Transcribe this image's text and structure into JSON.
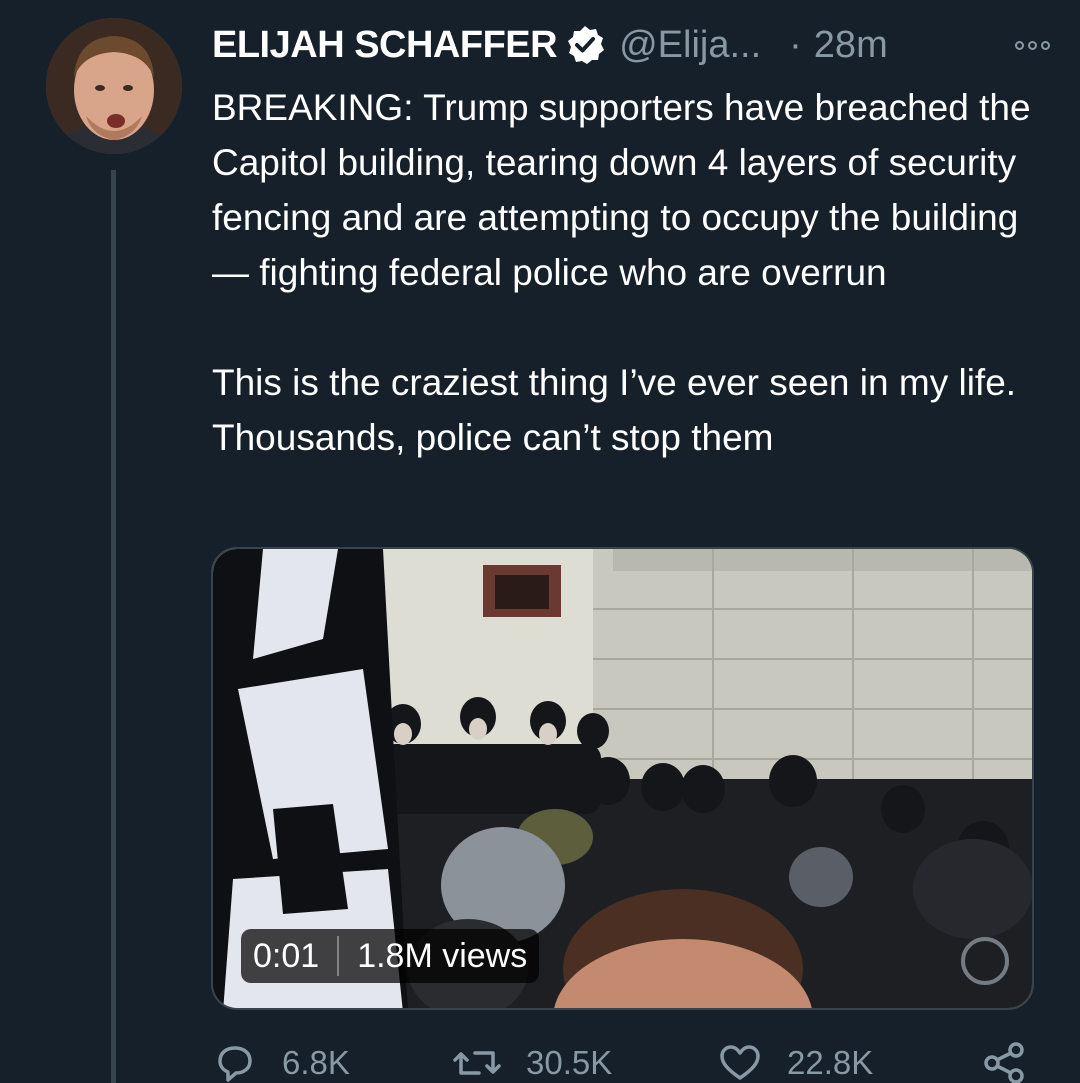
{
  "tweet": {
    "author_name": "ELIJAH SCHAFFER",
    "handle": "@Elija...",
    "separator": "·",
    "time": "28m",
    "paragraphs": [
      "BREAKING: Trump supporters have breached the Capitol building, tearing down 4 layers of security fencing and are attempting to occupy the building — fighting federal police who are overrun",
      "This is the craziest thing I’ve ever seen in my life. Thousands, police can’t stop them"
    ]
  },
  "media": {
    "timestamp": "0:01",
    "views": "1.8M views"
  },
  "actions": {
    "reply_count": "6.8K",
    "retweet_count": "30.5K",
    "like_count": "22.8K"
  },
  "icons": {
    "verified": "verified-badge-icon",
    "more": "more-options-icon",
    "reply": "reply-icon",
    "retweet": "retweet-icon",
    "like": "heart-icon",
    "share": "share-icon"
  },
  "colors": {
    "background": "#15202b",
    "secondary_text": "#8899a6",
    "thread_line": "#38444d"
  }
}
